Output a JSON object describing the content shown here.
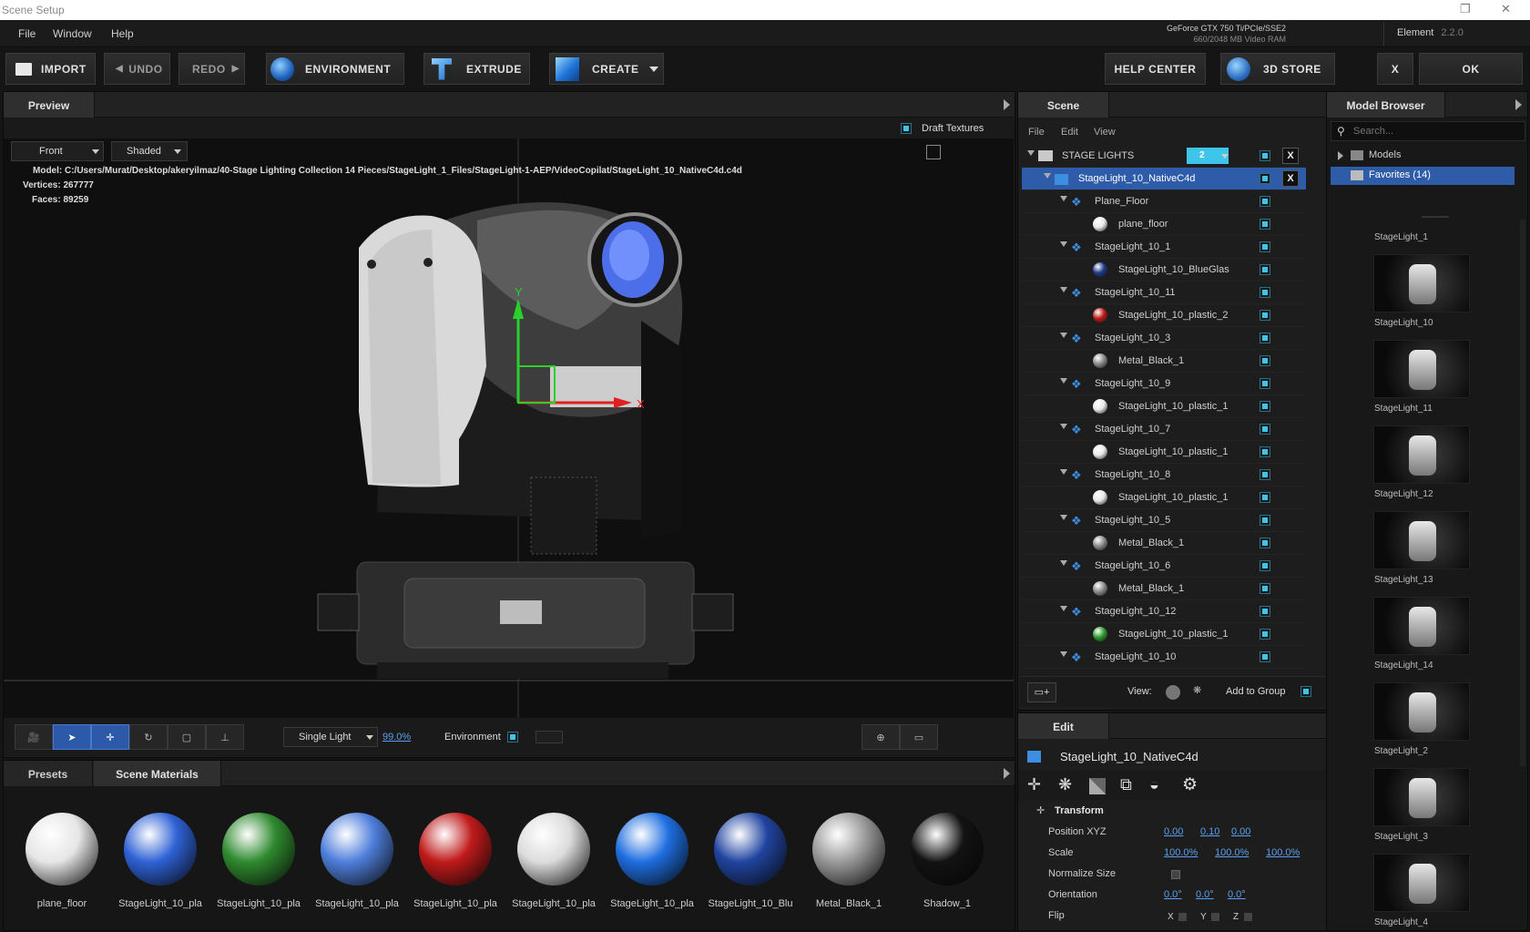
{
  "window": {
    "title": "Scene Setup"
  },
  "menu": {
    "items": [
      "File",
      "Window",
      "Help"
    ]
  },
  "gpu": {
    "name": "GeForce GTX 750 Ti/PCIe/SSE2",
    "vram": "660/2048 MB Video RAM"
  },
  "element": {
    "label": "Element",
    "version": "2.2.0"
  },
  "toolbar": {
    "import": "IMPORT",
    "undo": "UNDO",
    "redo": "REDO",
    "environment": "ENVIRONMENT",
    "extrude": "EXTRUDE",
    "create": "CREATE",
    "help_center": "HELP CENTER",
    "store": "3D STORE",
    "close": "X",
    "ok": "OK"
  },
  "preview": {
    "tab": "Preview",
    "draft_textures": "Draft Textures",
    "view_mode": "Front",
    "shade_mode": "Shaded",
    "model_label": "Model:",
    "model_path": "C:/Users/Murat/Desktop/akeryilmaz/40-Stage Lighting Collection 14 Pieces/StageLight_1_Files/StageLight-1-AEP/VideoCopilat/StageLight_10_NativeC4d.c4d",
    "vertices_label": "Vertices:",
    "vertices": "267777",
    "faces_label": "Faces:",
    "faces": "89259",
    "axis_x": "X",
    "axis_y": "Y",
    "light_mode": "Single Light",
    "light_pct": "99.0%",
    "environment_label": "Environment"
  },
  "materials": {
    "tabs": [
      "Presets",
      "Scene Materials"
    ],
    "items": [
      {
        "name": "plane_floor",
        "color": "#e6e6e6"
      },
      {
        "name": "StageLight_10_pla",
        "color": "#2f62d6"
      },
      {
        "name": "StageLight_10_pla",
        "color": "#2f8a2f"
      },
      {
        "name": "StageLight_10_pla",
        "color": "#4f7fdc"
      },
      {
        "name": "StageLight_10_pla",
        "color": "#c01a1a"
      },
      {
        "name": "StageLight_10_pla",
        "color": "#dcdcdc"
      },
      {
        "name": "StageLight_10_pla",
        "color": "#1e6ee0"
      },
      {
        "name": "StageLight_10_Blu",
        "color": "#2044a0"
      },
      {
        "name": "Metal_Black_1",
        "color": "#9a9a9a"
      },
      {
        "name": "Shadow_1",
        "color": "#121212"
      }
    ]
  },
  "scene": {
    "tab": "Scene",
    "menu": [
      "File",
      "Edit",
      "View"
    ],
    "group_count": "2",
    "rows": [
      {
        "label": "STAGE LIGHTS",
        "level": 0,
        "kind": "folder",
        "close": "X"
      },
      {
        "label": "StageLight_10_NativeC4d",
        "level": 1,
        "kind": "model",
        "selected": true,
        "close": "X"
      },
      {
        "label": "Plane_Floor",
        "level": 2,
        "kind": "mesh"
      },
      {
        "label": "plane_floor",
        "level": 3,
        "kind": "sphere",
        "color": "#e8e8e8"
      },
      {
        "label": "StageLight_10_1",
        "level": 2,
        "kind": "mesh"
      },
      {
        "label": "StageLight_10_BlueGlas",
        "level": 3,
        "kind": "sphere",
        "color": "#203a8a"
      },
      {
        "label": "StageLight_10_11",
        "level": 2,
        "kind": "mesh"
      },
      {
        "label": "StageLight_10_plastic_2",
        "level": 3,
        "kind": "sphere",
        "color": "#c01a1a"
      },
      {
        "label": "StageLight_10_3",
        "level": 2,
        "kind": "mesh"
      },
      {
        "label": "Metal_Black_1",
        "level": 3,
        "kind": "sphere",
        "color": "#8a8a8a"
      },
      {
        "label": "StageLight_10_9",
        "level": 2,
        "kind": "mesh"
      },
      {
        "label": "StageLight_10_plastic_1",
        "level": 3,
        "kind": "sphere",
        "color": "#e8e8e8"
      },
      {
        "label": "StageLight_10_7",
        "level": 2,
        "kind": "mesh"
      },
      {
        "label": "StageLight_10_plastic_1",
        "level": 3,
        "kind": "sphere",
        "color": "#e8e8e8"
      },
      {
        "label": "StageLight_10_8",
        "level": 2,
        "kind": "mesh"
      },
      {
        "label": "StageLight_10_plastic_1",
        "level": 3,
        "kind": "sphere",
        "color": "#e8e8e8"
      },
      {
        "label": "StageLight_10_5",
        "level": 2,
        "kind": "mesh"
      },
      {
        "label": "Metal_Black_1",
        "level": 3,
        "kind": "sphere",
        "color": "#8a8a8a"
      },
      {
        "label": "StageLight_10_6",
        "level": 2,
        "kind": "mesh"
      },
      {
        "label": "Metal_Black_1",
        "level": 3,
        "kind": "sphere",
        "color": "#8a8a8a"
      },
      {
        "label": "StageLight_10_12",
        "level": 2,
        "kind": "mesh"
      },
      {
        "label": "StageLight_10_plastic_1",
        "level": 3,
        "kind": "sphere",
        "color": "#2f9a2f"
      },
      {
        "label": "StageLight_10_10",
        "level": 2,
        "kind": "mesh"
      }
    ],
    "view_label": "View:",
    "add_to_group": "Add to Group"
  },
  "edit": {
    "tab": "Edit",
    "object": "StageLight_10_NativeC4d",
    "section": "Transform",
    "position_label": "Position XYZ",
    "position": [
      "0.00",
      "0.10",
      "0.00"
    ],
    "scale_label": "Scale",
    "scale": [
      "100.0%",
      "100.0%",
      "100.0%"
    ],
    "normalize_label": "Normalize Size",
    "orientation_label": "Orientation",
    "orientation": [
      "0.0°",
      "0.0°",
      "0.0°"
    ],
    "flip_label": "Flip",
    "flip_axes": [
      "X",
      "Y",
      "Z"
    ]
  },
  "model_browser": {
    "tab": "Model Browser",
    "search_placeholder": "Search...",
    "tree": [
      "Models",
      "Favorites (14)"
    ],
    "items": [
      "StageLight_1",
      "StageLight_10",
      "StageLight_11",
      "StageLight_12",
      "StageLight_13",
      "StageLight_14",
      "StageLight_2",
      "StageLight_3",
      "StageLight_4"
    ]
  },
  "colors": {
    "accent": "#2f5ca9",
    "checkbox": "#3fc5ea",
    "link": "#5aa0f0"
  }
}
